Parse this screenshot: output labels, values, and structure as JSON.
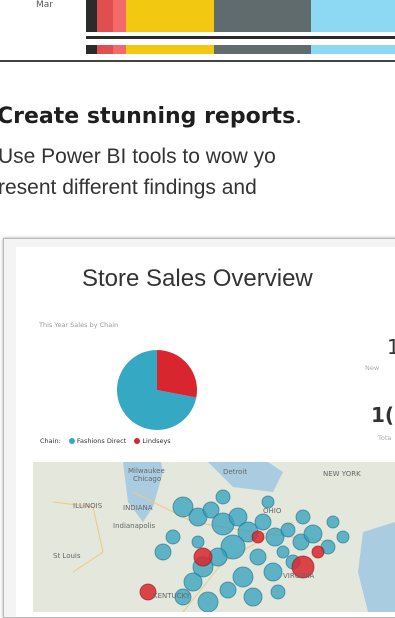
{
  "top_chart": {
    "row_label": "Mar",
    "colors": {
      "dark": "#333333",
      "red": "#e04f4f",
      "salmon": "#f26a6a",
      "yellow": "#f2c811",
      "gray": "#5f6b6d",
      "teal": "#2eb8cf",
      "lightblue": "#7fd3f0"
    }
  },
  "headline": {
    "bold": "Create stunning reports",
    "suffix": ".",
    "line1": "Use Power BI tools to wow yo",
    "line2": "resent different findings and"
  },
  "dashboard": {
    "title": "Store Sales Overview",
    "pie_title": "This Year Sales by Chain",
    "legend": {
      "label": "Chain",
      "items": [
        {
          "name": "Fashions Direct",
          "color": "#35a8c3"
        },
        {
          "name": "Lindseys",
          "color": "#d9262e"
        }
      ]
    },
    "kpi_1": {
      "value": "1",
      "label": "New"
    },
    "kpi_2": {
      "value": "1(",
      "label": "Tota"
    },
    "map": {
      "labels": [
        "Milwaukee",
        "Chicago",
        "Detroit",
        "NEW YORK",
        "ILLINOIS",
        "INDIANA",
        "Indianapolis",
        "St Louis",
        "OHIO",
        "VIRGINIA",
        "KENTUCKY"
      ]
    }
  },
  "chart_data": {
    "type": "pie",
    "title": "This Year Sales by Chain",
    "categories": [
      "Fashions Direct",
      "Lindseys"
    ],
    "values": [
      72,
      28
    ]
  }
}
